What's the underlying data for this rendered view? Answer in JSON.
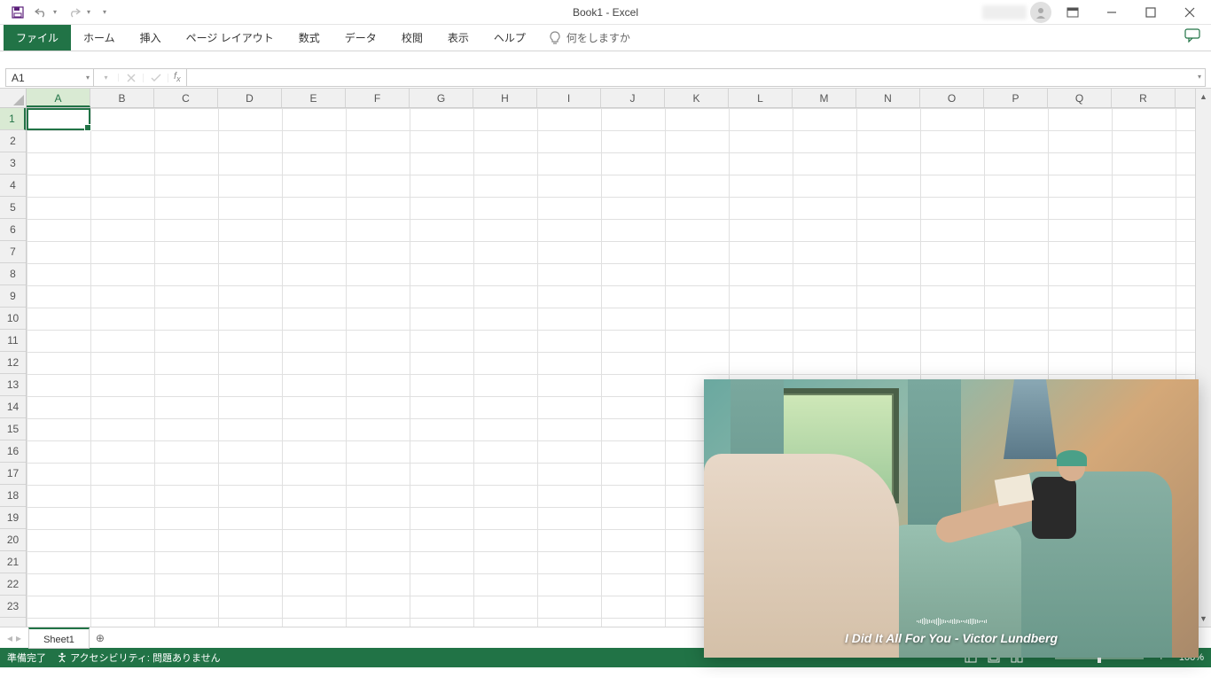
{
  "title": "Book1  -  Excel",
  "qat": {
    "save": "save",
    "undo": "undo",
    "redo": "redo"
  },
  "tabs": [
    "ファイル",
    "ホーム",
    "挿入",
    "ページ レイアウト",
    "数式",
    "データ",
    "校閲",
    "表示",
    "ヘルプ"
  ],
  "tell_me": "何をしますか",
  "name_box": "A1",
  "formula": "",
  "columns": [
    "A",
    "B",
    "C",
    "D",
    "E",
    "F",
    "G",
    "H",
    "I",
    "J",
    "K",
    "L",
    "M",
    "N",
    "O",
    "P",
    "Q",
    "R"
  ],
  "rows": [
    "1",
    "2",
    "3",
    "4",
    "5",
    "6",
    "7",
    "8",
    "9",
    "10",
    "11",
    "12",
    "13",
    "14",
    "15",
    "16",
    "17",
    "18",
    "19",
    "20",
    "21",
    "22",
    "23"
  ],
  "active_cell": "A1",
  "sheet_tab": "Sheet1",
  "status": {
    "ready": "準備完了",
    "accessibility": "アクセシビリティ: 問題ありません",
    "zoom": "100%"
  },
  "pip_caption": "I Did It All For You - Victor Lundberg"
}
